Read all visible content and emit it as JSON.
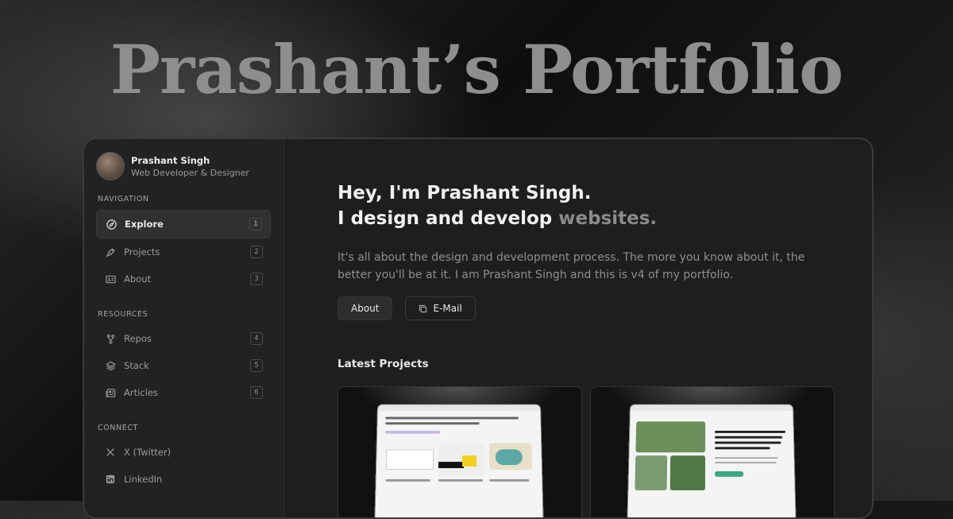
{
  "hero": {
    "title": "Prashant’s Portfolio"
  },
  "profile": {
    "name": "Prashant Singh",
    "role": "Web Developer & Designer"
  },
  "sections": {
    "navigation": "NAVIGATION",
    "resources": "RESOURCES",
    "connect": "CONNECT"
  },
  "nav": [
    {
      "label": "Explore",
      "badge": "1",
      "icon": "compass-icon"
    },
    {
      "label": "Projects",
      "badge": "2",
      "icon": "pen-tool-icon"
    },
    {
      "label": "About",
      "badge": "3",
      "icon": "id-card-icon"
    }
  ],
  "resources": [
    {
      "label": "Repos",
      "badge": "4",
      "icon": "git-branch-icon"
    },
    {
      "label": "Stack",
      "badge": "5",
      "icon": "layers-icon"
    },
    {
      "label": "Articles",
      "badge": "6",
      "icon": "newspaper-icon"
    }
  ],
  "connect": [
    {
      "label": "X (Twitter)",
      "icon": "x-icon"
    },
    {
      "label": "LinkedIn",
      "icon": "linkedin-icon"
    }
  ],
  "main": {
    "headline_line1": "Hey, I'm Prashant Singh.",
    "headline_line2_prefix": "I design and develop ",
    "headline_line2_accent": "websites.",
    "intro": "It's all about the design and development process. The more you know about it, the better you'll be at it. I am Prashant Singh and this is v4 of my portfolio.",
    "about_button": "About",
    "email_button": "E-Mail",
    "latest_projects": "Latest Projects"
  },
  "colors": {
    "accent_muted": "#8a8a8a",
    "background": "#1e1e1e"
  }
}
